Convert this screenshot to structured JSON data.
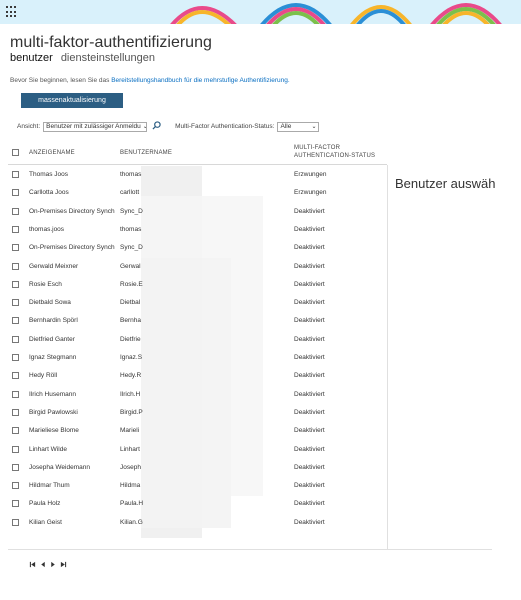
{
  "header": {
    "launcher_icon": "app-launcher-icon",
    "banner_color": "#d9f1fb"
  },
  "page": {
    "title": "multi-faktor-authentifizierung",
    "tabs": [
      {
        "label": "benutzer",
        "active": true
      },
      {
        "label": "diensteinstellungen",
        "active": false
      }
    ],
    "intro_prefix": "Bevor Sie beginnen, lesen Sie das ",
    "intro_link": "Bereitstellungshandbuch für die mehrstufige Authentifizierung.",
    "bulk_update_label": "massenaktualisierung",
    "accent_color": "#2c5e83"
  },
  "filters": {
    "view_label": "Ansicht:",
    "view_value": "Benutzer mit zulässiger Anmeldu",
    "search_icon": "search-icon",
    "status_label": "Multi-Factor Authentication-Status:",
    "status_value": "Alle"
  },
  "table": {
    "columns": {
      "display_name": "ANZEIGENAME",
      "user_name": "BENUTZERNAME",
      "mfa_status_line1": "MULTI-FACTOR",
      "mfa_status_line2": "AUTHENTICATION-STATUS"
    },
    "rows": [
      {
        "display_name": "Thomas Joos",
        "user_name": "thomas",
        "status": "Erzwungen"
      },
      {
        "display_name": "Carllotta Joos",
        "user_name": "carllott",
        "status": "Erzwungen"
      },
      {
        "display_name": "On-Premises Directory Synchr",
        "user_name": "Sync_D",
        "status": "Deaktiviert"
      },
      {
        "display_name": "thomas.joos",
        "user_name": "thomas",
        "status": "Deaktiviert"
      },
      {
        "display_name": "On-Premises Directory Synchr",
        "user_name": "Sync_D",
        "status": "Deaktiviert"
      },
      {
        "display_name": "Gerwald Meixner",
        "user_name": "Gerwal",
        "status": "Deaktiviert"
      },
      {
        "display_name": "Rosie Esch",
        "user_name": "Rosie.E",
        "status": "Deaktiviert"
      },
      {
        "display_name": "Dietbald Sowa",
        "user_name": "Dietbal",
        "status": "Deaktiviert"
      },
      {
        "display_name": "Bernhardin Spörl",
        "user_name": "Bernha",
        "status": "Deaktiviert"
      },
      {
        "display_name": "Dietfried Ganter",
        "user_name": "Dietfrie",
        "status": "Deaktiviert"
      },
      {
        "display_name": "Ignaz Stegmann",
        "user_name": "Ignaz.S",
        "status": "Deaktiviert"
      },
      {
        "display_name": "Hedy Röll",
        "user_name": "Hedy.R",
        "status": "Deaktiviert"
      },
      {
        "display_name": "Ilrich Husemann",
        "user_name": "Ilrich.H",
        "status": "Deaktiviert"
      },
      {
        "display_name": "Birgid Pawlowski",
        "user_name": "Birgid.P",
        "status": "Deaktiviert"
      },
      {
        "display_name": "Marieliese Blome",
        "user_name": "Marieli",
        "status": "Deaktiviert"
      },
      {
        "display_name": "Linhart Wilde",
        "user_name": "Linhart",
        "status": "Deaktiviert"
      },
      {
        "display_name": "Josepha Weidemann",
        "user_name": "Joseph",
        "status": "Deaktiviert"
      },
      {
        "display_name": "Hildmar Thum",
        "user_name": "Hildma",
        "status": "Deaktiviert"
      },
      {
        "display_name": "Paula Holz",
        "user_name": "Paula.H",
        "status": "Deaktiviert"
      },
      {
        "display_name": "Kilian Geist",
        "user_name": "Kilian.G",
        "status": "Deaktiviert"
      }
    ]
  },
  "side_panel": {
    "title": "Benutzer auswäh"
  },
  "pager": {
    "icons": [
      "first-page-icon",
      "prev-page-icon",
      "next-page-icon",
      "last-page-icon"
    ]
  }
}
